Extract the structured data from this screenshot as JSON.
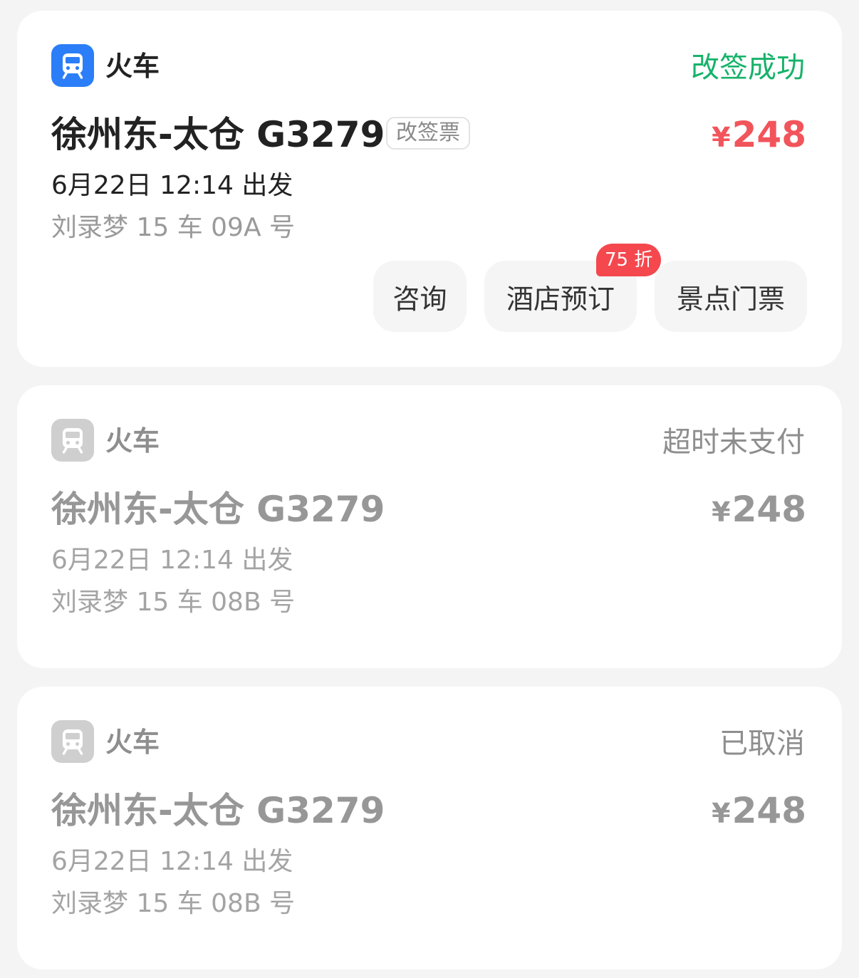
{
  "orders": [
    {
      "type_label": "火车",
      "type_icon": "train-icon",
      "status": "改签成功",
      "route": "徐州东-太仓 G3279",
      "tag": "改签票",
      "currency": "¥",
      "price": "248",
      "depart": "6月22日 12:14 出发",
      "seat": "刘录梦 15 车 09A 号",
      "actions": {
        "consult": "咨询",
        "hotel": "酒店预订",
        "ticket": "景点门票",
        "hotel_badge": "75 折"
      }
    },
    {
      "type_label": "火车",
      "type_icon": "train-icon",
      "status": "超时未支付",
      "route": "徐州东-太仓 G3279",
      "currency": "¥",
      "price": "248",
      "depart": "6月22日 12:14 出发",
      "seat": "刘录梦 15 车 08B 号"
    },
    {
      "type_label": "火车",
      "type_icon": "train-icon",
      "status": "已取消",
      "route": "徐州东-太仓 G3279",
      "currency": "¥",
      "price": "248",
      "depart": "6月22日 12:14 出发",
      "seat": "刘录梦 15 车 08B 号"
    }
  ],
  "colors": {
    "active_icon": "#2b7ef8",
    "inactive_icon": "#cfcfcf",
    "success_status": "#17b26a",
    "price_active": "#f2545b",
    "badge": "#f4484e",
    "inactive_text": "#979797"
  }
}
